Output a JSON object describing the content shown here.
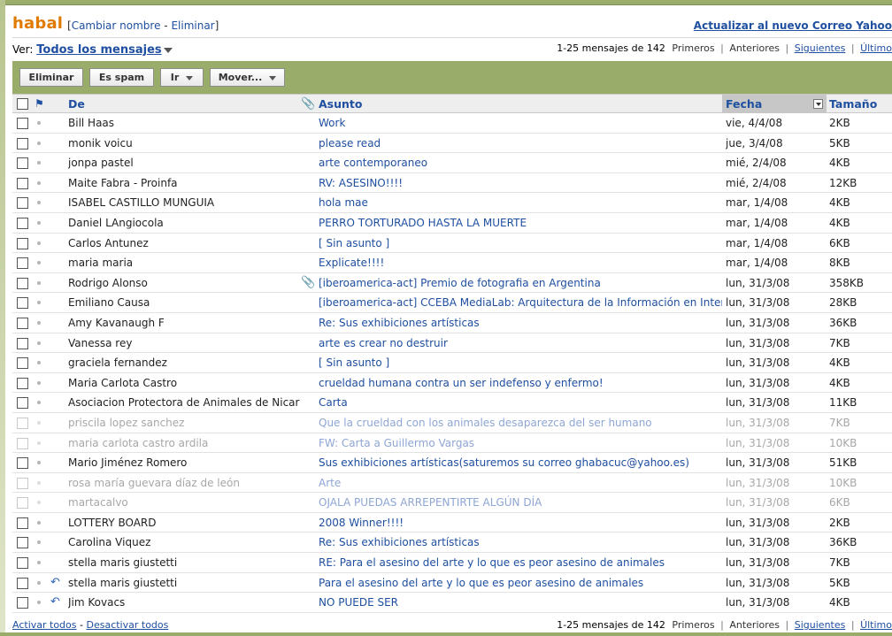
{
  "header": {
    "brand": "habal",
    "rename_link": "Cambiar nombre",
    "delete_link": "Eliminar",
    "upgrade_link": "Actualizar al nuevo Correo Yahoo"
  },
  "viewbar": {
    "label": "Ver:",
    "view_value": "Todos los mensajes"
  },
  "pager": {
    "range": "1-25 mensajes de 142",
    "first": "Primeros",
    "previous": "Anteriores",
    "next": "Siguientes",
    "last": "Último"
  },
  "toolbar": {
    "delete": "Eliminar",
    "spam": "Es spam",
    "go": "Ir",
    "move": "Mover..."
  },
  "columns": {
    "from": "De",
    "subject": "Asunto",
    "date": "Fecha",
    "size": "Tamaño"
  },
  "messages": [
    {
      "from": "Bill Haas",
      "subject": "Work",
      "date": "vie, 4/4/08",
      "size": "2KB"
    },
    {
      "from": "monik voicu",
      "subject": "please read",
      "date": "jue, 3/4/08",
      "size": "5KB"
    },
    {
      "from": "jonpa pastel",
      "subject": "arte contemporaneo",
      "date": "mié, 2/4/08",
      "size": "4KB"
    },
    {
      "from": "Maite Fabra - Proinfa",
      "subject": "RV: ASESINO!!!!",
      "date": "mié, 2/4/08",
      "size": "12KB"
    },
    {
      "from": "ISABEL CASTILLO MUNGUIA",
      "subject": "hola mae",
      "date": "mar, 1/4/08",
      "size": "4KB"
    },
    {
      "from": "Daniel LAngiocola",
      "subject": "PERRO TORTURADO HASTA LA MUERTE",
      "date": "mar, 1/4/08",
      "size": "4KB"
    },
    {
      "from": "Carlos Antunez",
      "subject": "[ Sin asunto ]",
      "date": "mar, 1/4/08",
      "size": "6KB"
    },
    {
      "from": "maria maria",
      "subject": "Explicate!!!!",
      "date": "mar, 1/4/08",
      "size": "8KB"
    },
    {
      "from": "Rodrigo Alonso",
      "subject": "[iberoamerica-act] Premio de fotografia en Argentina",
      "date": "lun, 31/3/08",
      "size": "358KB"
    },
    {
      "from": "Emiliano Causa",
      "subject": "[iberoamerica-act] CCEBA MediaLab: Arquitectura de la Información en Interne",
      "date": "lun, 31/3/08",
      "size": "28KB"
    },
    {
      "from": "Amy Kavanaugh F",
      "subject": "Re: Sus exhibiciones artísticas",
      "date": "lun, 31/3/08",
      "size": "36KB"
    },
    {
      "from": "Vanessa rey",
      "subject": "arte es crear no destruir",
      "date": "lun, 31/3/08",
      "size": "7KB"
    },
    {
      "from": "graciela fernandez",
      "subject": "[ Sin asunto ]",
      "date": "lun, 31/3/08",
      "size": "4KB"
    },
    {
      "from": "Maria Carlota Castro",
      "subject": "crueldad humana contra un ser indefenso y enfermo!",
      "date": "lun, 31/3/08",
      "size": "4KB"
    },
    {
      "from": "Asociacion Protectora de Animales de Nicara",
      "subject": "Carta",
      "date": "lun, 31/3/08",
      "size": "11KB"
    },
    {
      "from": "priscila lopez sanchez",
      "subject": "Que la crueldad con los animales desaparezca del ser humano",
      "date": "lun, 31/3/08",
      "size": "7KB"
    },
    {
      "from": "maria carlota castro ardila",
      "subject": "FW: Carta a Guillermo Vargas",
      "date": "lun, 31/3/08",
      "size": "10KB"
    },
    {
      "from": "Mario Jiménez Romero",
      "subject": "Sus exhibiciones artísticas(saturemos su correo ghabacuc@yahoo.es)",
      "date": "lun, 31/3/08",
      "size": "51KB"
    },
    {
      "from": "rosa maría guevara díaz de león",
      "subject": "Arte",
      "date": "lun, 31/3/08",
      "size": "10KB"
    },
    {
      "from": "martacalvo",
      "subject": "OJALA PUEDAS ARREPENTIRTE ALGÚN DÍA",
      "date": "lun, 31/3/08",
      "size": "6KB"
    },
    {
      "from": "LOTTERY BOARD",
      "subject": "2008 Winner!!!!",
      "date": "lun, 31/3/08",
      "size": "2KB"
    },
    {
      "from": "Carolina Viquez",
      "subject": "Re: Sus exhibiciones artísticas",
      "date": "lun, 31/3/08",
      "size": "36KB"
    },
    {
      "from": "stella maris giustetti",
      "subject": "RE: Para el asesino del arte y lo que es peor asesino de animales",
      "date": "lun, 31/3/08",
      "size": "7KB"
    },
    {
      "from": "stella maris giustetti",
      "subject": "Para el asesino del arte y lo que es peor asesino de animales",
      "date": "lun, 31/3/08",
      "size": "5KB"
    },
    {
      "from": "Jim Kovacs",
      "subject": "NO PUEDE SER",
      "date": "lun, 31/3/08",
      "size": "4KB"
    }
  ],
  "footer": {
    "select_all": "Activar todos",
    "deselect_all": "Desactivar todos"
  }
}
